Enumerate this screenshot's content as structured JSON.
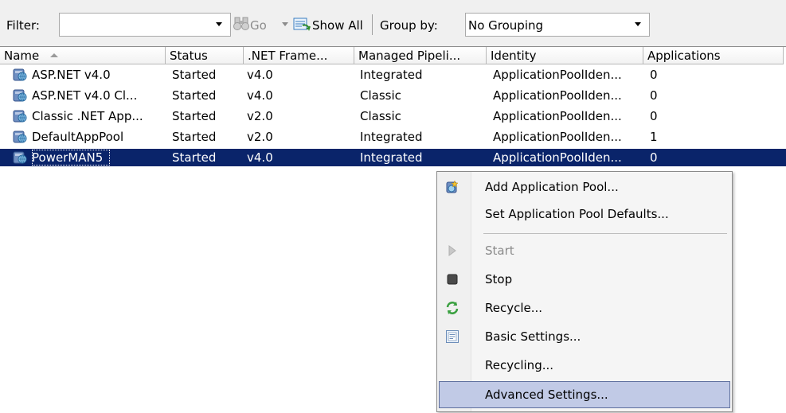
{
  "toolbar": {
    "filter_label": "Filter:",
    "filter_value": "",
    "go_label": "Go",
    "show_all_label": "Show All",
    "group_by_label": "Group by:",
    "group_by_value": "No Grouping"
  },
  "grid": {
    "columns": [
      "Name",
      "Status",
      ".NET Frame...",
      "Managed Pipeli...",
      "Identity",
      "Applications"
    ],
    "sort_column": "Name",
    "rows": [
      {
        "name": "ASP.NET v4.0",
        "status": "Started",
        "net": "v4.0",
        "pipeline": "Integrated",
        "identity": "ApplicationPoolIden...",
        "apps": "0"
      },
      {
        "name": "ASP.NET v4.0 Cl...",
        "status": "Started",
        "net": "v4.0",
        "pipeline": "Classic",
        "identity": "ApplicationPoolIden...",
        "apps": "0"
      },
      {
        "name": "Classic .NET App...",
        "status": "Started",
        "net": "v2.0",
        "pipeline": "Classic",
        "identity": "ApplicationPoolIden...",
        "apps": "0"
      },
      {
        "name": "DefaultAppPool",
        "status": "Started",
        "net": "v2.0",
        "pipeline": "Integrated",
        "identity": "ApplicationPoolIden...",
        "apps": "1"
      },
      {
        "name": "PowerMAN5",
        "status": "Started",
        "net": "v4.0",
        "pipeline": "Integrated",
        "identity": "ApplicationPoolIden...",
        "apps": "0"
      }
    ],
    "selected_row": 4
  },
  "context_menu": {
    "items": [
      {
        "label": "Add Application Pool...",
        "icon": "add-pool-icon",
        "enabled": true
      },
      {
        "label": "Set Application Pool Defaults...",
        "icon": "",
        "enabled": true
      },
      {
        "label": "Start",
        "icon": "start-icon",
        "enabled": false
      },
      {
        "label": "Stop",
        "icon": "stop-icon",
        "enabled": true
      },
      {
        "label": "Recycle...",
        "icon": "recycle-icon",
        "enabled": true
      },
      {
        "label": "Basic Settings...",
        "icon": "basic-settings-icon",
        "enabled": true
      },
      {
        "label": "Recycling...",
        "icon": "",
        "enabled": true
      },
      {
        "label": "Advanced Settings...",
        "icon": "",
        "enabled": true,
        "highlighted": true
      }
    ]
  },
  "colors": {
    "selection": "#0a246a",
    "menu_highlight": "#c1cae6",
    "menu_highlight_border": "#5e6f9e"
  }
}
